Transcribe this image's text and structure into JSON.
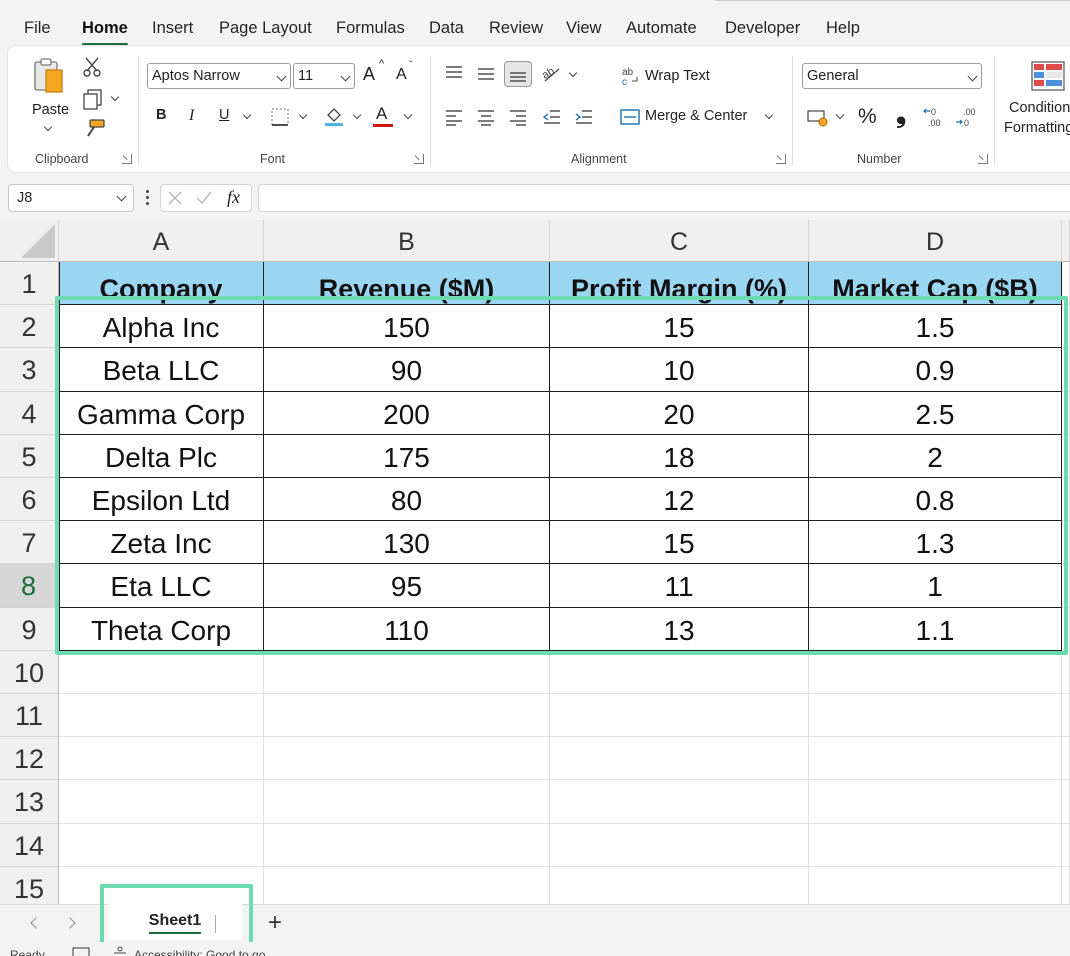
{
  "menu": {
    "tabs": [
      "File",
      "Home",
      "Insert",
      "Page Layout",
      "Formulas",
      "Data",
      "Review",
      "View",
      "Automate",
      "Developer",
      "Help"
    ],
    "active": "Home"
  },
  "ribbon": {
    "clipboard": {
      "label": "Clipboard",
      "paste_label": "Paste"
    },
    "font": {
      "label": "Font",
      "font_name": "Aptos Narrow",
      "font_size": "11",
      "bold": "B",
      "italic": "I",
      "underline": "U",
      "grow": "A",
      "shrink": "A",
      "font_color_glyph": "A"
    },
    "alignment": {
      "label": "Alignment",
      "wrap_text": "Wrap Text",
      "merge_center": "Merge & Center"
    },
    "number": {
      "label": "Number",
      "format": "General",
      "percent": "%",
      "comma": "❟"
    },
    "styles": {
      "conditional_line1": "Condition",
      "conditional_line2": "Formatting"
    }
  },
  "formula_bar": {
    "name_box": "J8",
    "fx": "fx",
    "value": ""
  },
  "sheet": {
    "columns": [
      "A",
      "B",
      "C",
      "D"
    ],
    "rows": [
      "1",
      "2",
      "3",
      "4",
      "5",
      "6",
      "7",
      "8",
      "9",
      "10",
      "11",
      "12",
      "13",
      "14",
      "15"
    ],
    "selected_row": "8",
    "headers": [
      "Company",
      "Revenue ($M)",
      "Profit Margin (%)",
      "Market Cap ($B)"
    ],
    "data": [
      [
        "Alpha Inc",
        "150",
        "15",
        "1.5"
      ],
      [
        "Beta LLC",
        "90",
        "10",
        "0.9"
      ],
      [
        "Gamma Corp",
        "200",
        "20",
        "2.5"
      ],
      [
        "Delta Plc",
        "175",
        "18",
        "2"
      ],
      [
        "Epsilon Ltd",
        "80",
        "12",
        "0.8"
      ],
      [
        "Zeta Inc",
        "130",
        "15",
        "1.3"
      ],
      [
        "Eta LLC",
        "95",
        "11",
        "1"
      ],
      [
        "Theta Corp",
        "110",
        "13",
        "1.1"
      ]
    ],
    "header_fill": "#9ad6f2",
    "highlight_color": "#6ddbb0"
  },
  "tabs_bar": {
    "sheet_name": "Sheet1",
    "add": "+"
  },
  "status": {
    "ready": "Ready",
    "accessibility": "Accessibility: Good to go"
  }
}
